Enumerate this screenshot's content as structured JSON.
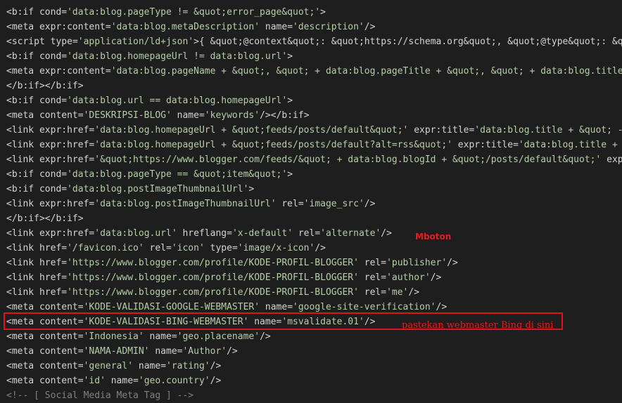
{
  "editor": {
    "lines": [
      "<b:if cond='data:blog.pageType != &quot;error_page&quot;'>",
      "<meta expr:content='data:blog.metaDescription' name='description'/>",
      "<script type='application/ld+json'>{ &quot;@context&quot;: &quot;https://schema.org&quot;, &quot;@type&quot;: &quo",
      "<b:if cond='data:blog.homepageUrl != data:blog.url'>",
      "<meta expr:content='data:blog.pageName + &quot;, &quot; + data:blog.pageTitle + &quot;, &quot; + data:blog.title'",
      "</b:if></b:if>",
      "<b:if cond='data:blog.url == data:blog.homepageUrl'>",
      "<meta content='DESKRIPSI-BLOG' name='keywords'/></b:if>",
      "<link expr:href='data:blog.homepageUrl + &quot;feeds/posts/default&quot;' expr:title='data:blog.title + &quot; - A",
      "<link expr:href='data:blog.homepageUrl + &quot;feeds/posts/default?alt=rss&quot;' expr:title='data:blog.title + &q",
      "<link expr:href='&quot;https://www.blogger.com/feeds/&quot; + data:blog.blogId + &quot;/posts/default&quot;' expr:",
      "<b:if cond='data:blog.pageType == &quot;item&quot;'>",
      "<b:if cond='data:blog.postImageThumbnailUrl'>",
      "<link expr:href='data:blog.postImageThumbnailUrl' rel='image_src'/>",
      "</b:if></b:if>",
      "<link expr:href='data:blog.url' hreflang='x-default' rel='alternate'/>",
      "<link href='/favicon.ico' rel='icon' type='image/x-icon'/>",
      "<link href='https://www.blogger.com/profile/KODE-PROFIL-BLOGGER' rel='publisher'/>",
      "<link href='https://www.blogger.com/profile/KODE-PROFIL-BLOGGER' rel='author'/>",
      "<link href='https://www.blogger.com/profile/KODE-PROFIL-BLOGGER' rel='me'/>",
      "<meta content='KODE-VALIDASI-GOOGLE-WEBMASTER' name='google-site-verification'/>",
      "<meta content='KODE-VALIDASI-BING-WEBMASTER' name='msvalidate.01'/>",
      "<meta content='Indonesia' name='geo.placename'/>",
      "<meta content='NAMA-ADMIN' name='Author'/>",
      "<meta content='general' name='rating'/>",
      "<meta content='id' name='geo.country'/>",
      "<!-- [ Social Media Meta Tag ] -->"
    ]
  },
  "annotations": {
    "watermark": "Mboton",
    "instruction": "pastekan webmaster Bing di sini"
  },
  "colors": {
    "background": "#1e1e1e",
    "attribute": "#4ec9b0",
    "value": "#b5cea8",
    "comment": "#808080",
    "annotation": "#e81c1c"
  }
}
